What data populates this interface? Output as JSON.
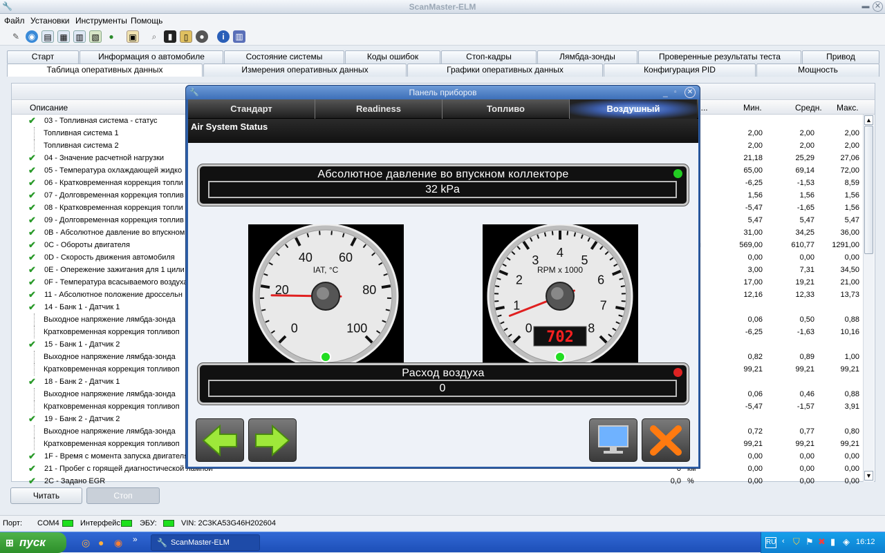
{
  "app": {
    "title": "ScanMaster-ELM"
  },
  "menu": [
    "Файл",
    "Установки",
    "Инструменты",
    "Помощь"
  ],
  "tabs_row1": [
    "Старт",
    "Информация о автомобиле",
    "Состояние системы",
    "Коды ошибок",
    "Стоп-кадры",
    "Лямбда-зонды",
    "Проверенные результаты теста",
    "Привод"
  ],
  "tabs_row2": [
    "Таблица оперативных данных",
    "Измерения оперативных данных",
    "Графики оперативных данных",
    "Конфигурация PID",
    "Мощность"
  ],
  "table": {
    "headers": {
      "desc": "Описание",
      "trunc": "н...",
      "min": "Мин.",
      "avg": "Средн.",
      "max": "Макс."
    },
    "rows": [
      {
        "check": true,
        "indent": false,
        "desc": "03 - Топливная система - статус",
        "val": "",
        "unit": "",
        "min": "",
        "avg": "",
        "max": ""
      },
      {
        "check": false,
        "indent": true,
        "desc": "Топливная система 1",
        "val": "",
        "unit": "",
        "min": "2,00",
        "avg": "2,00",
        "max": "2,00"
      },
      {
        "check": false,
        "indent": true,
        "desc": "Топливная система 2",
        "val": "",
        "unit": "",
        "min": "2,00",
        "avg": "2,00",
        "max": "2,00"
      },
      {
        "check": true,
        "indent": false,
        "desc": "04 - Значение расчетной нагрузки",
        "val": "",
        "unit": "",
        "min": "21,18",
        "avg": "25,29",
        "max": "27,06"
      },
      {
        "check": true,
        "indent": false,
        "desc": "05 - Температура охлаждающей жидко",
        "val": "",
        "unit": "",
        "min": "65,00",
        "avg": "69,14",
        "max": "72,00"
      },
      {
        "check": true,
        "indent": false,
        "desc": "06 - Кратковременная коррекция топли",
        "val": "",
        "unit": "",
        "min": "-6,25",
        "avg": "-1,53",
        "max": "8,59"
      },
      {
        "check": true,
        "indent": false,
        "desc": "07 - Долговременная коррекция топлив",
        "val": "",
        "unit": "",
        "min": "1,56",
        "avg": "1,56",
        "max": "1,56"
      },
      {
        "check": true,
        "indent": false,
        "desc": "08 - Кратковременная коррекция топли",
        "val": "",
        "unit": "",
        "min": "-5,47",
        "avg": "-1,65",
        "max": "1,56"
      },
      {
        "check": true,
        "indent": false,
        "desc": "09 - Долговременная коррекция топлив",
        "val": "",
        "unit": "",
        "min": "5,47",
        "avg": "5,47",
        "max": "5,47"
      },
      {
        "check": true,
        "indent": false,
        "desc": "0B - Абсолютное давление во впускном",
        "val": "",
        "unit": "",
        "min": "31,00",
        "avg": "34,25",
        "max": "36,00"
      },
      {
        "check": true,
        "indent": false,
        "desc": "0C - Обороты двигателя",
        "val": "",
        "unit": "мин",
        "min": "569,00",
        "avg": "610,77",
        "max": "1291,00"
      },
      {
        "check": true,
        "indent": false,
        "desc": "0D - Скорость движения автомобиля",
        "val": "",
        "unit": "н",
        "min": "0,00",
        "avg": "0,00",
        "max": "0,00"
      },
      {
        "check": true,
        "indent": false,
        "desc": "0E - Опережение зажигания для 1 цили",
        "val": "",
        "unit": "",
        "min": "3,00",
        "avg": "7,31",
        "max": "34,50"
      },
      {
        "check": true,
        "indent": false,
        "desc": "0F - Температура всасываемого воздуха",
        "val": "",
        "unit": "",
        "min": "17,00",
        "avg": "19,21",
        "max": "21,00"
      },
      {
        "check": true,
        "indent": false,
        "desc": "11 - Абсолютное положение дроссельн",
        "val": "",
        "unit": "",
        "min": "12,16",
        "avg": "12,33",
        "max": "13,73"
      },
      {
        "check": true,
        "indent": false,
        "desc": "14 - Банк 1 - Датчик 1",
        "val": "",
        "unit": "",
        "min": "",
        "avg": "",
        "max": ""
      },
      {
        "check": false,
        "indent": true,
        "desc": "Выходное напряжение лямбда-зонда",
        "val": "",
        "unit": "",
        "min": "0,06",
        "avg": "0,50",
        "max": "0,88"
      },
      {
        "check": false,
        "indent": true,
        "desc": "Кратковременная коррекция топливоп",
        "val": "",
        "unit": "",
        "min": "-6,25",
        "avg": "-1,63",
        "max": "10,16"
      },
      {
        "check": true,
        "indent": false,
        "desc": "15 - Банк 1 - Датчик 2",
        "val": "",
        "unit": "",
        "min": "",
        "avg": "",
        "max": ""
      },
      {
        "check": false,
        "indent": true,
        "desc": "Выходное напряжение лямбда-зонда",
        "val": "",
        "unit": "",
        "min": "0,82",
        "avg": "0,89",
        "max": "1,00"
      },
      {
        "check": false,
        "indent": true,
        "desc": "Кратковременная коррекция топливоп",
        "val": "",
        "unit": "",
        "min": "99,21",
        "avg": "99,21",
        "max": "99,21"
      },
      {
        "check": true,
        "indent": false,
        "desc": "18 - Банк 2 - Датчик 1",
        "val": "",
        "unit": "",
        "min": "",
        "avg": "",
        "max": ""
      },
      {
        "check": false,
        "indent": true,
        "desc": "Выходное напряжение лямбда-зонда",
        "val": "",
        "unit": "",
        "min": "0,06",
        "avg": "0,46",
        "max": "0,88"
      },
      {
        "check": false,
        "indent": true,
        "desc": "Кратковременная коррекция топливоп",
        "val": "",
        "unit": "",
        "min": "-5,47",
        "avg": "-1,57",
        "max": "3,91"
      },
      {
        "check": true,
        "indent": false,
        "desc": "19 - Банк 2 - Датчик 2",
        "val": "",
        "unit": "",
        "min": "",
        "avg": "",
        "max": ""
      },
      {
        "check": false,
        "indent": true,
        "desc": "Выходное напряжение лямбда-зонда",
        "val": "",
        "unit": "",
        "min": "0,72",
        "avg": "0,77",
        "max": "0,80"
      },
      {
        "check": false,
        "indent": true,
        "desc": "Кратковременная коррекция топливоп",
        "val": "",
        "unit": "",
        "min": "99,21",
        "avg": "99,21",
        "max": "99,21"
      },
      {
        "check": true,
        "indent": false,
        "desc": "1F - Время с момента запуска двигателя",
        "val": "",
        "unit": "",
        "min": "0,00",
        "avg": "0,00",
        "max": "0,00"
      },
      {
        "check": true,
        "indent": false,
        "desc": "21 - Пробег с горящей диагностической лампой",
        "val": "0",
        "unit": "км",
        "min": "0,00",
        "avg": "0,00",
        "max": "0,00"
      },
      {
        "check": true,
        "indent": false,
        "desc": "2C - Задано EGR",
        "val": "0,0",
        "unit": "%",
        "min": "0,00",
        "avg": "0,00",
        "max": "0,00"
      }
    ]
  },
  "buttons": {
    "read": "Читать",
    "stop": "Стоп"
  },
  "status": {
    "port_label": "Порт:",
    "port_value": "COM4",
    "interface_label": "Интерфейс:",
    "ecu_label": "ЭБУ:",
    "vin": "VIN: 2C3KA53G46H202604"
  },
  "taskbar": {
    "start": "пуск",
    "item": "ScanMaster-ELM",
    "lang": "RU",
    "clock": "16:12"
  },
  "dialog": {
    "title": "Панель приборов",
    "tabs": [
      "Стандарт",
      "Readiness",
      "Топливо",
      "Воздушный"
    ],
    "active_tab": 3,
    "section": "Air System Status",
    "panel1": {
      "label": "Абсолютное давление во впускном коллекторе",
      "value": "32 kPa",
      "led": "#22cc22"
    },
    "panel2": {
      "label": "Расход воздуха",
      "value": "0",
      "led": "#dd2222"
    },
    "gauge_iat": {
      "title": "IAT, °C",
      "min": 0,
      "max": 100,
      "ticks": [
        "0",
        "20",
        "40",
        "60",
        "80",
        "100"
      ],
      "value": 17
    },
    "gauge_rpm": {
      "title": "RPM x 1000",
      "min": 0,
      "max": 8,
      "ticks": [
        "0",
        "1",
        "2",
        "3",
        "4",
        "5",
        "6",
        "7",
        "8"
      ],
      "value": 0.702,
      "digital": "702"
    }
  },
  "colors": {
    "accent": "#2e5fa8",
    "check": "#2a9a2a",
    "needle": "#e02020"
  }
}
